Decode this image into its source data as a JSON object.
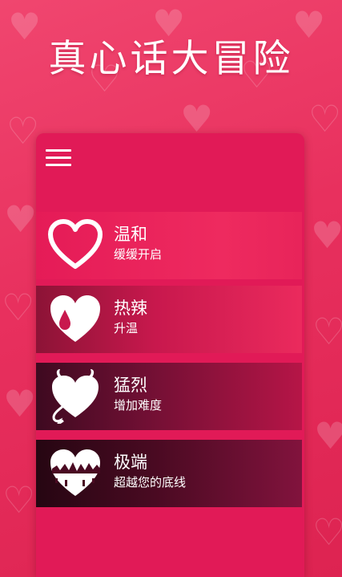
{
  "app": {
    "title": "真心话大冒险"
  },
  "colors": {
    "background": "#e8305e",
    "card": "#e11a57",
    "text": "#ffffff"
  },
  "menu": {
    "icon": "hamburger-menu-icon"
  },
  "modes": [
    {
      "name": "温和",
      "description": "缓缓开启",
      "icon": "heart-outline-icon"
    },
    {
      "name": "热辣",
      "description": "升温",
      "icon": "heart-drop-icon"
    },
    {
      "name": "猛烈",
      "description": "增加难度",
      "icon": "devil-heart-icon"
    },
    {
      "name": "极端",
      "description": "超越您的底线",
      "icon": "broken-heart-icon"
    }
  ]
}
